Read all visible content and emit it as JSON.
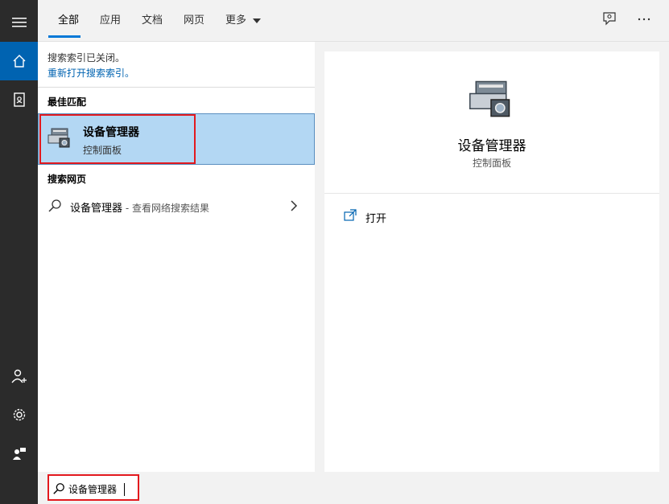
{
  "tabs": [
    {
      "label": "全部",
      "active": true
    },
    {
      "label": "应用"
    },
    {
      "label": "文档"
    },
    {
      "label": "网页"
    },
    {
      "label": "更多"
    }
  ],
  "left": {
    "index_notice": "搜索索引已关闭。",
    "index_link": "重新打开搜索索引。",
    "best_match_heading": "最佳匹配",
    "best_match": {
      "title": "设备管理器",
      "subtitle": "控制面板"
    },
    "web_heading": "搜索网页",
    "web_result": {
      "query": "设备管理器",
      "suffix": " - 查看网络搜索结果"
    }
  },
  "right": {
    "title": "设备管理器",
    "subtitle": "控制面板",
    "open_label": "打开"
  },
  "search": {
    "value": "设备管理器"
  },
  "rail_icons": [
    "hamburger-icon",
    "home-icon",
    "notebook-icon",
    "add-user-icon",
    "gear-icon",
    "feedback-icon"
  ],
  "colors": {
    "accent": "#0078d7",
    "highlight": "#b3d7f3",
    "rail": "#2b2b2b",
    "outline": "#e3191e"
  }
}
